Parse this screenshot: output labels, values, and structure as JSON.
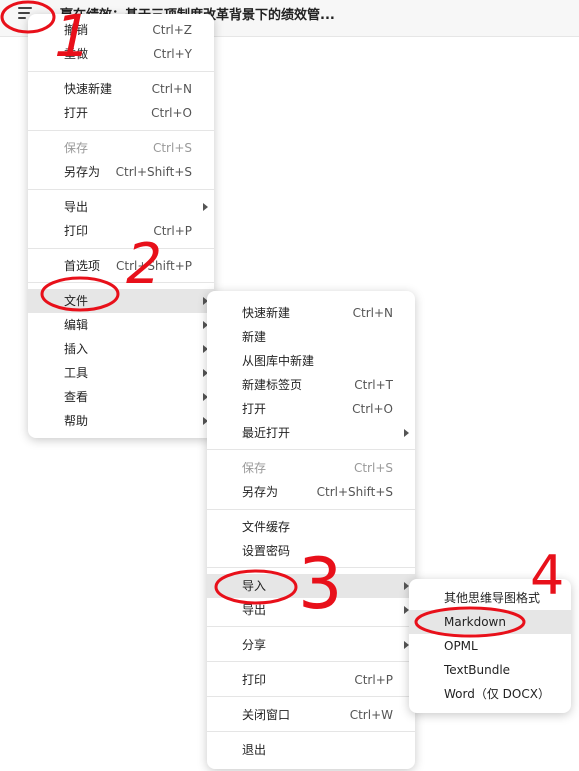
{
  "title": "赢在绩效：基于三项制度改革背景下的绩效管...",
  "main_menu": [
    {
      "label": "撤销",
      "shortcut": "Ctrl+Z"
    },
    {
      "label": "重做",
      "shortcut": "Ctrl+Y"
    },
    {
      "label": "快速新建",
      "shortcut": "Ctrl+N"
    },
    {
      "label": "打开",
      "shortcut": "Ctrl+O"
    },
    {
      "label": "保存",
      "shortcut": "Ctrl+S",
      "disabled": true
    },
    {
      "label": "另存为",
      "shortcut": "Ctrl+Shift+S"
    },
    {
      "label": "导出",
      "submenu": true
    },
    {
      "label": "打印",
      "shortcut": "Ctrl+P"
    },
    {
      "label": "首选项",
      "shortcut": "Ctrl+Shift+P"
    },
    {
      "label": "文件",
      "submenu": true,
      "highlighted": true
    },
    {
      "label": "编辑",
      "submenu": true
    },
    {
      "label": "插入",
      "submenu": true
    },
    {
      "label": "工具",
      "submenu": true
    },
    {
      "label": "查看",
      "submenu": true
    },
    {
      "label": "帮助",
      "submenu": true
    }
  ],
  "file_menu": [
    {
      "label": "快速新建",
      "shortcut": "Ctrl+N"
    },
    {
      "label": "新建"
    },
    {
      "label": "从图库中新建"
    },
    {
      "label": "新建标签页",
      "shortcut": "Ctrl+T"
    },
    {
      "label": "打开",
      "shortcut": "Ctrl+O"
    },
    {
      "label": "最近打开",
      "submenu": true
    },
    {
      "label": "保存",
      "shortcut": "Ctrl+S",
      "disabled": true
    },
    {
      "label": "另存为",
      "shortcut": "Ctrl+Shift+S"
    },
    {
      "label": "文件缓存"
    },
    {
      "label": "设置密码"
    },
    {
      "label": "导入",
      "submenu": true,
      "highlighted": true
    },
    {
      "label": "导出",
      "submenu": true
    },
    {
      "label": "分享",
      "submenu": true
    },
    {
      "label": "打印",
      "shortcut": "Ctrl+P"
    },
    {
      "label": "关闭窗口",
      "shortcut": "Ctrl+W"
    },
    {
      "label": "退出"
    }
  ],
  "import_menu": [
    {
      "label": "其他思维导图格式"
    },
    {
      "label": "Markdown",
      "highlighted": true
    },
    {
      "label": "OPML"
    },
    {
      "label": "TextBundle"
    },
    {
      "label": "Word（仅 DOCX）"
    }
  ],
  "annotations": {
    "color": "#e8101a",
    "numbers": [
      "1",
      "2",
      "3",
      "4"
    ]
  }
}
